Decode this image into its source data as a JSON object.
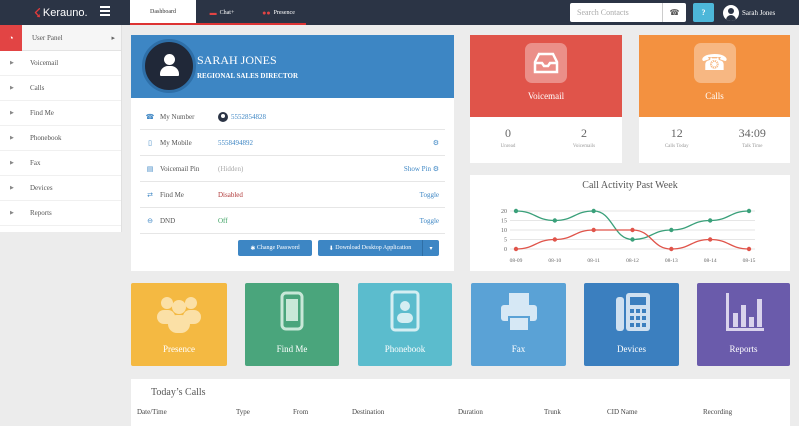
{
  "app": {
    "logo_text": "Kerauno.",
    "tabs": [
      {
        "label": "Dashboard",
        "icon": "dashboard"
      },
      {
        "label": "Chat",
        "icon": "chat-bubble-icon",
        "suffix": "+"
      },
      {
        "label": "Presence",
        "icon": "users-icon"
      }
    ],
    "search": {
      "placeholder": "Search Contacts",
      "value": ""
    },
    "help_label": "?",
    "user_name": "Sarah Jones"
  },
  "sidebar": {
    "panel_label": "User Panel",
    "items": [
      {
        "label": "Voicemail"
      },
      {
        "label": "Calls"
      },
      {
        "label": "Find Me"
      },
      {
        "label": "Phonebook"
      },
      {
        "label": "Fax"
      },
      {
        "label": "Devices"
      },
      {
        "label": "Reports"
      }
    ]
  },
  "profile": {
    "name": "SARAH JONES",
    "title": "REGIONAL SALES DIRECTOR",
    "rows": [
      {
        "label": "My Number",
        "value": "5552854828",
        "icon": "phone-icon"
      },
      {
        "label": "My Mobile",
        "value": "5558494892",
        "icon": "mobile-icon",
        "action_icon": "gear-icon"
      },
      {
        "label": "Voicemail Pin",
        "value": "(Hidden)",
        "icon": "voicemail-icon",
        "action": "Show Pin",
        "action_icon": "gear-icon"
      },
      {
        "label": "Find Me",
        "value": "Disabled",
        "icon": "arrows-icon",
        "action": "Toggle"
      },
      {
        "label": "DND",
        "value": "Off",
        "icon": "minus-circle-icon",
        "action": "Toggle"
      }
    ],
    "buttons": {
      "change_password": "Change Password",
      "download": "Download Desktop Application"
    }
  },
  "stats": {
    "voicemail": {
      "label": "Voicemail",
      "a_num": "0",
      "a_sub": "Unread",
      "b_num": "2",
      "b_sub": "Voicemails",
      "color": "#e0544a"
    },
    "calls": {
      "label": "Calls",
      "a_num": "12",
      "a_sub": "Calls Today",
      "b_num": "34:09",
      "b_sub": "Talk Time",
      "color": "#f39140"
    }
  },
  "chart_data": {
    "type": "line",
    "title": "Call Activity Past Week",
    "categories": [
      "08-09",
      "08-10",
      "08-11",
      "08-12",
      "08-13",
      "08-14",
      "08-15"
    ],
    "ylim": [
      0,
      20
    ],
    "yticks": [
      0,
      5,
      10,
      15,
      20
    ],
    "series": [
      {
        "values": [
          20,
          15,
          20,
          5,
          10,
          15,
          20
        ],
        "color": "#3aa07a"
      },
      {
        "values": [
          0,
          5,
          10,
          10,
          0,
          5,
          0
        ],
        "color": "#e0544a"
      }
    ],
    "grid": true
  },
  "tiles": [
    {
      "label": "Presence",
      "color": "#f4b942",
      "icon": "presence-icon"
    },
    {
      "label": "Find Me",
      "color": "#4aa57c",
      "icon": "mobile-icon"
    },
    {
      "label": "Phonebook",
      "color": "#5bbccd",
      "icon": "phonebook-icon"
    },
    {
      "label": "Fax",
      "color": "#5aa2d6",
      "icon": "fax-icon"
    },
    {
      "label": "Devices",
      "color": "#3b7fbf",
      "icon": "devices-icon"
    },
    {
      "label": "Reports",
      "color": "#6a5bab",
      "icon": "reports-icon"
    }
  ],
  "calls_table": {
    "title": "Today’s Calls",
    "columns": [
      "Date/Time",
      "Type",
      "From",
      "Destination",
      "Duration",
      "Trunk",
      "CID Name",
      "Recording"
    ]
  }
}
